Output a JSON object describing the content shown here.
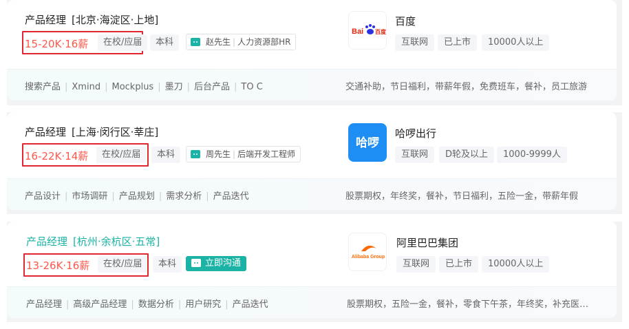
{
  "jobs": [
    {
      "title": "产品经理",
      "location": "[北京·海淀区·上地]",
      "salary": "15-20K·16薪",
      "experience": "在校/应届",
      "education": "本科",
      "recruiter_name": "赵先生",
      "recruiter_role": "人力资源部HR",
      "skills": [
        "搜索产品",
        "Xmind",
        "Mockplus",
        "墨刀",
        "后台产品",
        "TO C"
      ],
      "benefits": "交通补助，节日福利，带薪年假，免费班车，餐补，员工旅游",
      "company": {
        "name": "百度",
        "logo_icon": "baidu-logo-icon",
        "logo_text": "Bai百度",
        "industry": "互联网",
        "stage": "已上市",
        "size": "10000人以上"
      }
    },
    {
      "title": "产品经理",
      "location": "[上海·闵行区·莘庄]",
      "salary": "16-22K·14薪",
      "experience": "在校/应届",
      "education": "本科",
      "recruiter_name": "周先生",
      "recruiter_role": "后端开发工程师",
      "skills": [
        "产品设计",
        "市场调研",
        "产品规划",
        "需求分析",
        "产品迭代"
      ],
      "benefits": "股票期权，年终奖，餐补，节日福利，五险一金，带薪年假",
      "company": {
        "name": "哈啰出行",
        "logo_icon": "hello-logo-icon",
        "logo_text": "哈啰",
        "industry": "互联网",
        "stage": "D轮及以上",
        "size": "1000-9999人"
      }
    },
    {
      "title": "产品经理",
      "location": "[杭州·余杭区·五常]",
      "salary": "13-26K·16薪",
      "experience": "在校/应届",
      "education": "本科",
      "chat_label": "立即沟通",
      "skills": [
        "产品经理",
        "高级产品经理",
        "数据分析",
        "用户研究",
        "产品迭代"
      ],
      "benefits": "股票期权，五险一金，餐补，零食下午茶，年终奖，补充医疗保险",
      "company": {
        "name": "阿里巴巴集团",
        "logo_icon": "alibaba-logo-icon",
        "logo_text": "Alibaba Group",
        "industry": "互联网",
        "stage": "已上市",
        "size": "10000人以上"
      }
    }
  ],
  "colors": {
    "accent": "#1bb3a6",
    "salary": "#fe574a",
    "highlight_box": "#e0262e",
    "hello_blue": "#1e8ef5",
    "baidu_red": "#de2910",
    "baidu_blue": "#2932e1",
    "alibaba_orange": "#ff6a00"
  }
}
